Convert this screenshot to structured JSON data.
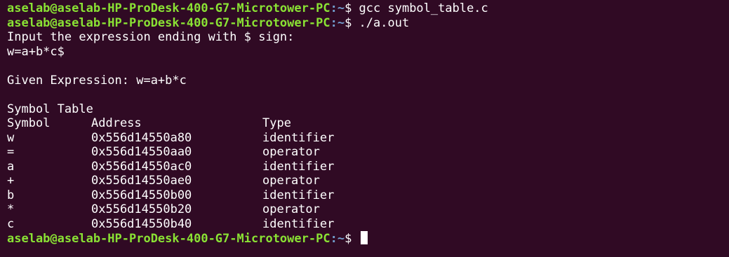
{
  "colors": {
    "background": "#300a24",
    "user_host": "#8ae234",
    "path": "#729fcf",
    "text": "#ffffff"
  },
  "prompt": {
    "user_host": "aselab@aselab-HP-ProDesk-400-G7-Microtower-PC",
    "path": ":~",
    "symbol": "$"
  },
  "lines": {
    "cmd1": " gcc symbol_table.c",
    "cmd2": " ./a.out",
    "prompt_input": "Input the expression ending with $ sign:",
    "input_echo": "w=a+b*c$",
    "given": "Given Expression: w=a+b*c",
    "table_title": "Symbol Table"
  },
  "table": {
    "headers": [
      "Symbol",
      "Address",
      "Type"
    ],
    "rows": [
      {
        "symbol": "w",
        "address": "0x556d14550a80",
        "type": "identifier"
      },
      {
        "symbol": "=",
        "address": "0x556d14550aa0",
        "type": "operator"
      },
      {
        "symbol": "a",
        "address": "0x556d14550ac0",
        "type": "identifier"
      },
      {
        "symbol": "+",
        "address": "0x556d14550ae0",
        "type": "operator"
      },
      {
        "symbol": "b",
        "address": "0x556d14550b00",
        "type": "identifier"
      },
      {
        "symbol": "*",
        "address": "0x556d14550b20",
        "type": "operator"
      },
      {
        "symbol": "c",
        "address": "0x556d14550b40",
        "type": "identifier"
      }
    ]
  }
}
